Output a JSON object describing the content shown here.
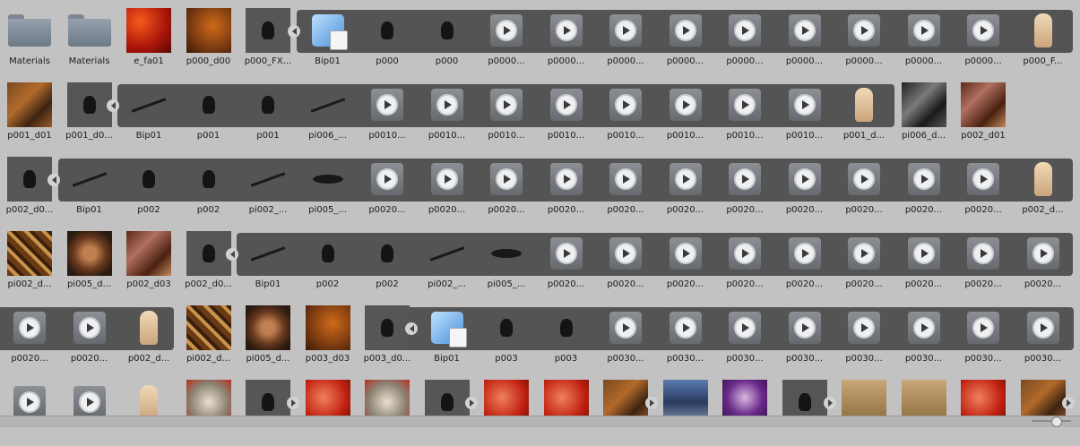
{
  "rows": [
    {
      "items": [
        {
          "kind": "folder",
          "label": "Materials"
        },
        {
          "kind": "folder",
          "label": "Materials"
        },
        {
          "kind": "tex",
          "tex": "fire",
          "label": "e_fa01"
        },
        {
          "kind": "tex",
          "tex": "brown",
          "label": "p000_d00"
        },
        {
          "kind": "dark",
          "label": "p000_FX..."
        },
        {
          "kind": "cube",
          "label": "Bip01"
        },
        {
          "kind": "figure",
          "label": "p000"
        },
        {
          "kind": "figure",
          "label": "p000"
        },
        {
          "kind": "play",
          "label": "p0000..."
        },
        {
          "kind": "play",
          "label": "p0000..."
        },
        {
          "kind": "play",
          "label": "p0000..."
        },
        {
          "kind": "play",
          "label": "p0000..."
        },
        {
          "kind": "play",
          "label": "p0000..."
        },
        {
          "kind": "play",
          "label": "p0000..."
        },
        {
          "kind": "play",
          "label": "p0000..."
        },
        {
          "kind": "play",
          "label": "p0000..."
        },
        {
          "kind": "play",
          "label": "p0000..."
        },
        {
          "kind": "dummy",
          "label": "p000_F..."
        }
      ]
    },
    {
      "items": [
        {
          "kind": "tex",
          "tex": "leather",
          "label": "p001_d01"
        },
        {
          "kind": "dark",
          "label": "p001_d0..."
        },
        {
          "kind": "spear",
          "label": "Bip01"
        },
        {
          "kind": "figure",
          "label": "p001"
        },
        {
          "kind": "figure",
          "label": "p001"
        },
        {
          "kind": "spear",
          "label": "pi006_..."
        },
        {
          "kind": "play",
          "label": "p0010..."
        },
        {
          "kind": "play",
          "label": "p0010..."
        },
        {
          "kind": "play",
          "label": "p0010..."
        },
        {
          "kind": "play",
          "label": "p0010..."
        },
        {
          "kind": "play",
          "label": "p0010..."
        },
        {
          "kind": "play",
          "label": "p0010..."
        },
        {
          "kind": "play",
          "label": "p0010..."
        },
        {
          "kind": "play",
          "label": "p0010..."
        },
        {
          "kind": "dummy",
          "label": "p001_d..."
        },
        {
          "kind": "tex",
          "tex": "metal",
          "label": "pi006_d..."
        },
        {
          "kind": "tex",
          "tex": "armor",
          "label": "p002_d01"
        }
      ]
    },
    {
      "items": [
        {
          "kind": "dark",
          "label": "p002_d0..."
        },
        {
          "kind": "spear",
          "label": "Bip01"
        },
        {
          "kind": "figure",
          "label": "p002"
        },
        {
          "kind": "figure",
          "label": "p002"
        },
        {
          "kind": "spear",
          "label": "pi002_..."
        },
        {
          "kind": "blob",
          "label": "pi005_..."
        },
        {
          "kind": "play",
          "label": "p0020..."
        },
        {
          "kind": "play",
          "label": "p0020..."
        },
        {
          "kind": "play",
          "label": "p0020..."
        },
        {
          "kind": "play",
          "label": "p0020..."
        },
        {
          "kind": "play",
          "label": "p0020..."
        },
        {
          "kind": "play",
          "label": "p0020..."
        },
        {
          "kind": "play",
          "label": "p0020..."
        },
        {
          "kind": "play",
          "label": "p0020..."
        },
        {
          "kind": "play",
          "label": "p0020..."
        },
        {
          "kind": "play",
          "label": "p0020..."
        },
        {
          "kind": "play",
          "label": "p0020..."
        },
        {
          "kind": "dummy",
          "label": "p002_d..."
        }
      ]
    },
    {
      "items": [
        {
          "kind": "tex",
          "tex": "pattern",
          "label": "pi002_d..."
        },
        {
          "kind": "tex",
          "tex": "shield",
          "label": "pi005_d..."
        },
        {
          "kind": "tex",
          "tex": "armor",
          "label": "p002_d03"
        },
        {
          "kind": "dark",
          "label": "p002_d0..."
        },
        {
          "kind": "spear",
          "label": "Bip01"
        },
        {
          "kind": "figure",
          "label": "p002"
        },
        {
          "kind": "figure",
          "label": "p002"
        },
        {
          "kind": "spear",
          "label": "pi002_..."
        },
        {
          "kind": "blob",
          "label": "pi005_..."
        },
        {
          "kind": "play",
          "label": "p0020..."
        },
        {
          "kind": "play",
          "label": "p0020..."
        },
        {
          "kind": "play",
          "label": "p0020..."
        },
        {
          "kind": "play",
          "label": "p0020..."
        },
        {
          "kind": "play",
          "label": "p0020..."
        },
        {
          "kind": "play",
          "label": "p0020..."
        },
        {
          "kind": "play",
          "label": "p0020..."
        },
        {
          "kind": "play",
          "label": "p0020..."
        },
        {
          "kind": "play",
          "label": "p0020..."
        }
      ]
    },
    {
      "items": [
        {
          "kind": "play",
          "label": "p0020..."
        },
        {
          "kind": "play",
          "label": "p0020..."
        },
        {
          "kind": "dummy",
          "label": "p002_d..."
        },
        {
          "kind": "tex",
          "tex": "pattern",
          "label": "pi002_d..."
        },
        {
          "kind": "tex",
          "tex": "shield",
          "label": "pi005_d..."
        },
        {
          "kind": "tex",
          "tex": "brown",
          "label": "p003_d03"
        },
        {
          "kind": "dark",
          "label": "p003_d0..."
        },
        {
          "kind": "cube",
          "label": "Bip01"
        },
        {
          "kind": "figure",
          "label": "p003"
        },
        {
          "kind": "figure",
          "label": "p003"
        },
        {
          "kind": "play",
          "label": "p0030..."
        },
        {
          "kind": "play",
          "label": "p0030..."
        },
        {
          "kind": "play",
          "label": "p0030..."
        },
        {
          "kind": "play",
          "label": "p0030..."
        },
        {
          "kind": "play",
          "label": "p0030..."
        },
        {
          "kind": "play",
          "label": "p0030..."
        },
        {
          "kind": "play",
          "label": "p0030..."
        },
        {
          "kind": "play",
          "label": "p0030..."
        }
      ]
    },
    {
      "items": [
        {
          "kind": "play",
          "label": ""
        },
        {
          "kind": "play",
          "label": ""
        },
        {
          "kind": "dummy",
          "label": ""
        },
        {
          "kind": "tex",
          "tex": "cartoon",
          "label": ""
        },
        {
          "kind": "dark",
          "label": ""
        },
        {
          "kind": "tex",
          "tex": "red",
          "label": ""
        },
        {
          "kind": "tex",
          "tex": "cartoon",
          "label": ""
        },
        {
          "kind": "dark",
          "label": ""
        },
        {
          "kind": "tex",
          "tex": "red",
          "label": ""
        },
        {
          "kind": "tex",
          "tex": "red",
          "label": ""
        },
        {
          "kind": "tex",
          "tex": "leather",
          "label": ""
        },
        {
          "kind": "tex",
          "tex": "blue",
          "label": ""
        },
        {
          "kind": "tex",
          "tex": "purple",
          "label": ""
        },
        {
          "kind": "dark",
          "label": ""
        },
        {
          "kind": "tex",
          "tex": "wood",
          "label": ""
        },
        {
          "kind": "tex",
          "tex": "wood",
          "label": ""
        },
        {
          "kind": "tex",
          "tex": "red",
          "label": ""
        },
        {
          "kind": "tex",
          "tex": "leather",
          "label": ""
        }
      ]
    }
  ]
}
